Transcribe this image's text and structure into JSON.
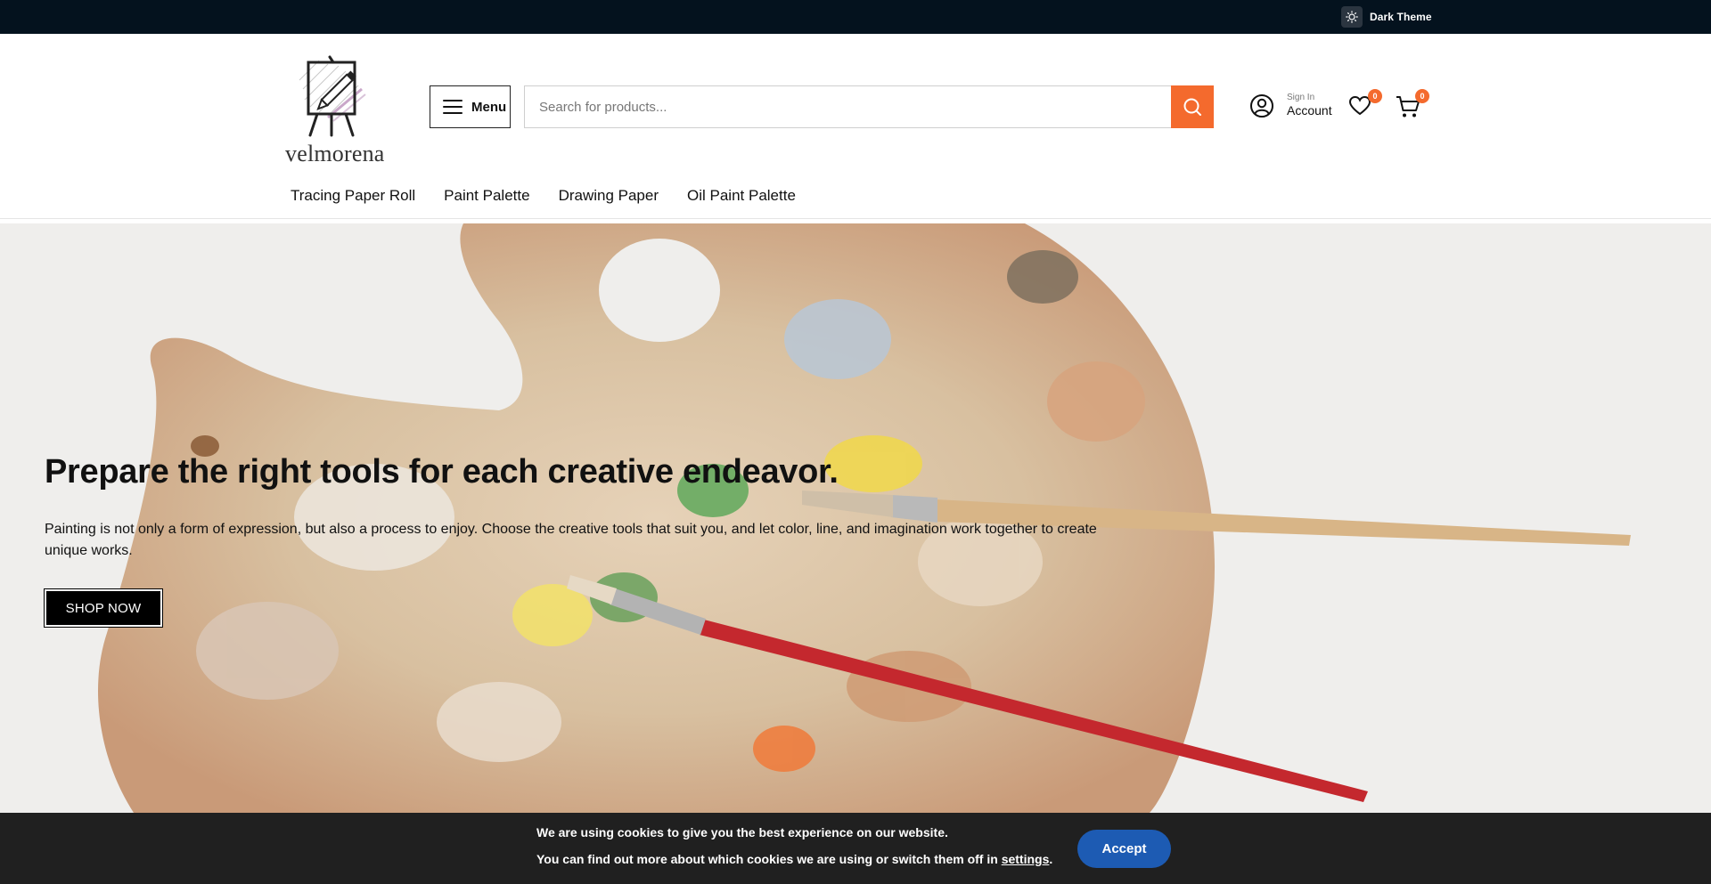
{
  "topbar": {
    "theme_toggle_label": "Dark Theme",
    "theme_icon": "sun-icon",
    "background": "#04121e"
  },
  "header": {
    "logo_text": "velmorena",
    "menu_label": "Menu",
    "search": {
      "placeholder": "Search for products...",
      "value": ""
    },
    "account": {
      "small_label": "Sign In",
      "label": "Account"
    },
    "wishlist_count": "0",
    "cart_count": "0",
    "accent_color": "#f46a2d"
  },
  "nav": {
    "items": [
      {
        "label": "Tracing Paper Roll"
      },
      {
        "label": "Paint Palette"
      },
      {
        "label": "Drawing Paper"
      },
      {
        "label": "Oil Paint Palette"
      }
    ]
  },
  "hero": {
    "title": "Prepare the right tools for each creative endeavor.",
    "text": "Painting is not only a form of expression, but also a process to enjoy. Choose the creative tools that suit you, and let color, line, and imagination work together to create unique works.",
    "button_label": "SHOP NOW"
  },
  "cookie_banner": {
    "line1": "We are using cookies to give you the best experience on our website.",
    "line2_prefix": "You can find out more about which cookies we are using or switch them off in ",
    "settings_link": "settings",
    "line2_suffix": ".",
    "accept_label": "Accept",
    "accept_color": "#1d5bb3"
  }
}
